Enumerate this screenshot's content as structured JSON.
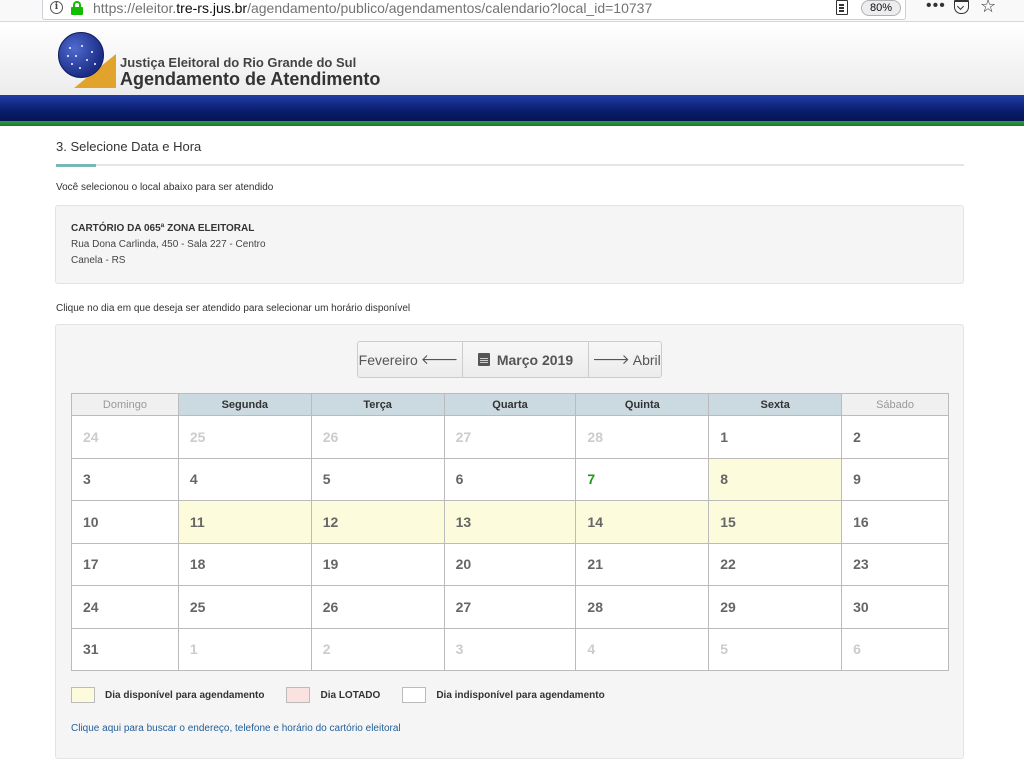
{
  "browser": {
    "url_prefix": "https://eleitor.",
    "url_domain": "tre-rs.jus.br",
    "url_path": "/agendamento/publico/agendamentos/calendario?local_id=10737",
    "zoom": "80%"
  },
  "header": {
    "org": "Justiça Eleitoral do Rio Grande do Sul",
    "title": "Agendamento de Atendimento"
  },
  "step": {
    "title": "3. Selecione Data e Hora",
    "intro": "Você selecionou o local abaixo para ser atendido"
  },
  "location": {
    "name": "CARTÓRIO DA 065ª ZONA ELEITORAL",
    "address": "Rua Dona Carlinda, 450 - Sala 227 - Centro",
    "city": "Canela - RS"
  },
  "hint": "Clique no dia em que deseja ser atendido para selecionar um horário disponível",
  "calendar": {
    "prev_label": "Fevereiro",
    "current_label": "Março 2019",
    "next_label": "Abril",
    "weekdays": [
      "Domingo",
      "Segunda",
      "Terça",
      "Quarta",
      "Quinta",
      "Sexta",
      "Sábado"
    ],
    "weeks": [
      [
        {
          "d": "24",
          "o": true
        },
        {
          "d": "25",
          "o": true
        },
        {
          "d": "26",
          "o": true
        },
        {
          "d": "27",
          "o": true
        },
        {
          "d": "28",
          "o": true
        },
        {
          "d": "1"
        },
        {
          "d": "2"
        }
      ],
      [
        {
          "d": "3"
        },
        {
          "d": "4"
        },
        {
          "d": "5"
        },
        {
          "d": "6"
        },
        {
          "d": "7",
          "today": true
        },
        {
          "d": "8",
          "a": true
        },
        {
          "d": "9"
        }
      ],
      [
        {
          "d": "10"
        },
        {
          "d": "11",
          "a": true
        },
        {
          "d": "12",
          "a": true
        },
        {
          "d": "13",
          "a": true
        },
        {
          "d": "14",
          "a": true
        },
        {
          "d": "15",
          "a": true
        },
        {
          "d": "16"
        }
      ],
      [
        {
          "d": "17"
        },
        {
          "d": "18"
        },
        {
          "d": "19"
        },
        {
          "d": "20"
        },
        {
          "d": "21"
        },
        {
          "d": "22"
        },
        {
          "d": "23"
        }
      ],
      [
        {
          "d": "24"
        },
        {
          "d": "25"
        },
        {
          "d": "26"
        },
        {
          "d": "27"
        },
        {
          "d": "28"
        },
        {
          "d": "29"
        },
        {
          "d": "30"
        }
      ],
      [
        {
          "d": "31"
        },
        {
          "d": "1",
          "o": true
        },
        {
          "d": "2",
          "o": true
        },
        {
          "d": "3",
          "o": true
        },
        {
          "d": "4",
          "o": true
        },
        {
          "d": "5",
          "o": true
        },
        {
          "d": "6",
          "o": true
        }
      ]
    ]
  },
  "legend": {
    "available": "Dia disponível para agendamento",
    "full": "Dia LOTADO",
    "unavailable": "Dia indisponível para agendamento"
  },
  "link": "Clique aqui para buscar o endereço, telefone e horário do cartório eleitoral",
  "colors": {
    "available": "#fcfcdc",
    "full": "#f9e2e0",
    "header_band": "#0a1d6e",
    "today": "#1c9a1c"
  }
}
